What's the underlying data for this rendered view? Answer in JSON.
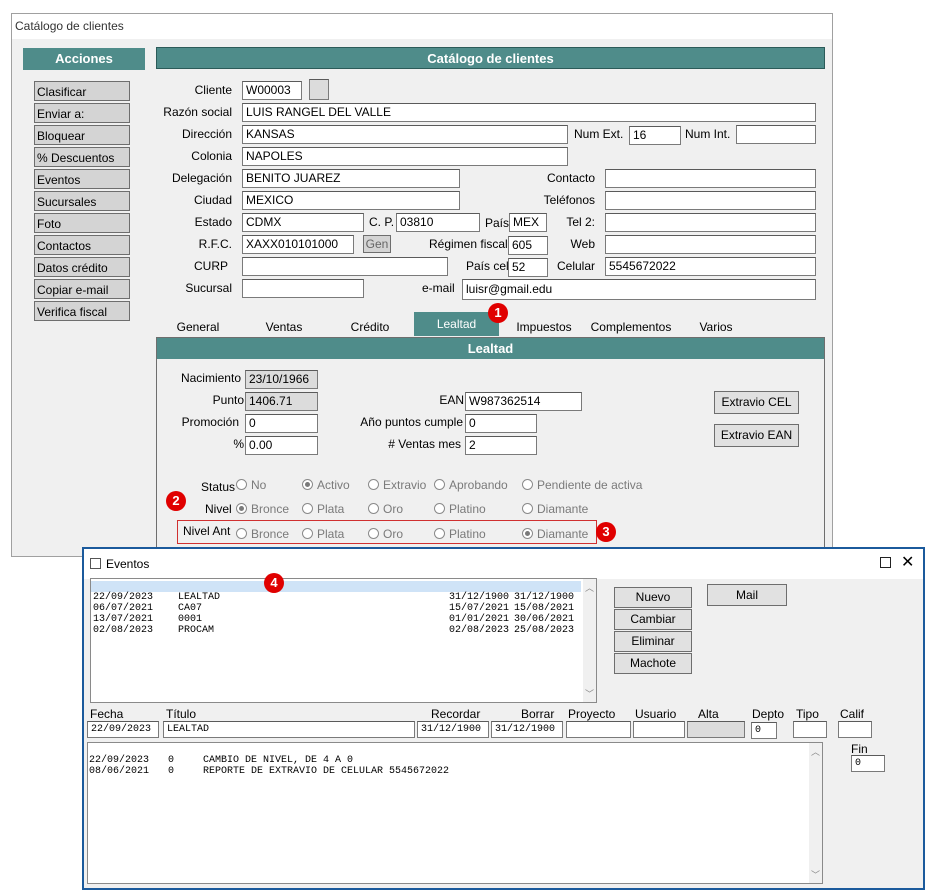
{
  "window": {
    "title": "Catálogo de clientes"
  },
  "actions": {
    "title": "Acciones",
    "items": [
      "Clasificar",
      "Enviar a:",
      "Bloquear",
      "% Descuentos",
      "Eventos",
      "Sucursales",
      "Foto",
      "Contactos",
      "Datos crédito",
      "Copiar e-mail",
      "Verifica fiscal"
    ]
  },
  "form": {
    "title": "Catálogo de clientes",
    "cliente_label": "Cliente",
    "cliente": "W00003",
    "razon_label": "Razón social",
    "razon": "LUIS RANGEL DEL VALLE",
    "direccion_label": "Dirección",
    "direccion": "KANSAS",
    "numext_label": "Num Ext.",
    "numext": "16",
    "numint_label": "Num Int.",
    "numint": "",
    "colonia_label": "Colonia",
    "colonia": "NAPOLES",
    "delegacion_label": "Delegación",
    "delegacion": "BENITO JUAREZ",
    "contacto_label": "Contacto",
    "contacto": "",
    "ciudad_label": "Ciudad",
    "ciudad": "MEXICO",
    "telefonos_label": "Teléfonos",
    "telefonos": "",
    "estado_label": "Estado",
    "estado": "CDMX",
    "cp_label": "C. P.",
    "cp": "03810",
    "pais_label": "País",
    "pais": "MEX",
    "tel2_label": "Tel 2:",
    "tel2": "",
    "rfc_label": "R.F.C.",
    "rfc": "XAXX010101000",
    "gen_label": "Gen",
    "regimen_label": "Régimen fiscal",
    "regimen": "605",
    "web_label": "Web",
    "web": "",
    "curp_label": "CURP",
    "curp": "",
    "paiscel_label": "País cel",
    "paiscel": "52",
    "celular_label": "Celular",
    "celular": "5545672022",
    "sucursal_label": "Sucursal",
    "sucursal": "",
    "email_label": "e-mail",
    "email": "luisr@gmail.edu"
  },
  "tabs": [
    "General",
    "Ventas",
    "Crédito",
    "Lealtad",
    "Impuestos",
    "Complementos",
    "Varios"
  ],
  "lealtad": {
    "title": "Lealtad",
    "nacimiento_label": "Nacimiento",
    "nacimiento": "23/10/1966",
    "punto_label": "Punto",
    "punto": "1406.71",
    "ean_label": "EAN",
    "ean": "W987362514",
    "promocion_label": "Promoción",
    "promocion": "0",
    "anio_label": "Año puntos cumple",
    "anio": "0",
    "pct_label": "%",
    "pct": "0.00",
    "ventas_label": "# Ventas mes",
    "ventas": "2",
    "extravio_cel": "Extravio CEL",
    "extravio_ean": "Extravio EAN",
    "status_label": "Status",
    "status_options": [
      "No",
      "Activo",
      "Extravio",
      "Aprobando",
      "Pendiente de activa"
    ],
    "nivel_label": "Nivel",
    "nivel_options": [
      "Bronce",
      "Plata",
      "Oro",
      "Platino",
      "Diamante"
    ],
    "nivelant_label": "Nivel Ant",
    "nivelant_options": [
      "Bronce",
      "Plata",
      "Oro",
      "Platino",
      "Diamante"
    ]
  },
  "badges": [
    "1",
    "2",
    "3",
    "4"
  ],
  "eventos": {
    "title": "Eventos",
    "list": [
      [
        "22/09/2023",
        "LEALTAD",
        "31/12/1900",
        "31/12/1900"
      ],
      [
        "06/07/2021",
        "CA07",
        "15/07/2021",
        "15/08/2021"
      ],
      [
        "13/07/2021",
        "0001",
        "01/01/2021",
        "30/06/2021"
      ],
      [
        "02/08/2023",
        "PROCAM",
        "02/08/2023",
        "25/08/2023"
      ]
    ],
    "buttons": [
      "Nuevo",
      "Cambiar",
      "Eliminar",
      "Machote"
    ],
    "mail": "Mail",
    "headers": [
      "Fecha",
      "Título",
      "Recordar",
      "Borrar",
      "Proyecto",
      "Usuario",
      "Alta",
      "Depto",
      "Tipo",
      "Calif"
    ],
    "fecha": "22/09/2023",
    "titulo": "LEALTAD",
    "recordar": "31/12/1900",
    "borrar": "31/12/1900",
    "proyecto": "",
    "usuario": "",
    "alta": "",
    "depto": "0",
    "tipo": "",
    "calif": "",
    "notes": [
      [
        "22/09/2023",
        "0",
        "CAMBIO DE NIVEL, DE 4 A 0"
      ],
      [
        "08/06/2021",
        "0",
        "REPORTE DE EXTRAVIO DE CELULAR 5545672022"
      ]
    ],
    "fin_label": "Fin",
    "fin": "0"
  }
}
